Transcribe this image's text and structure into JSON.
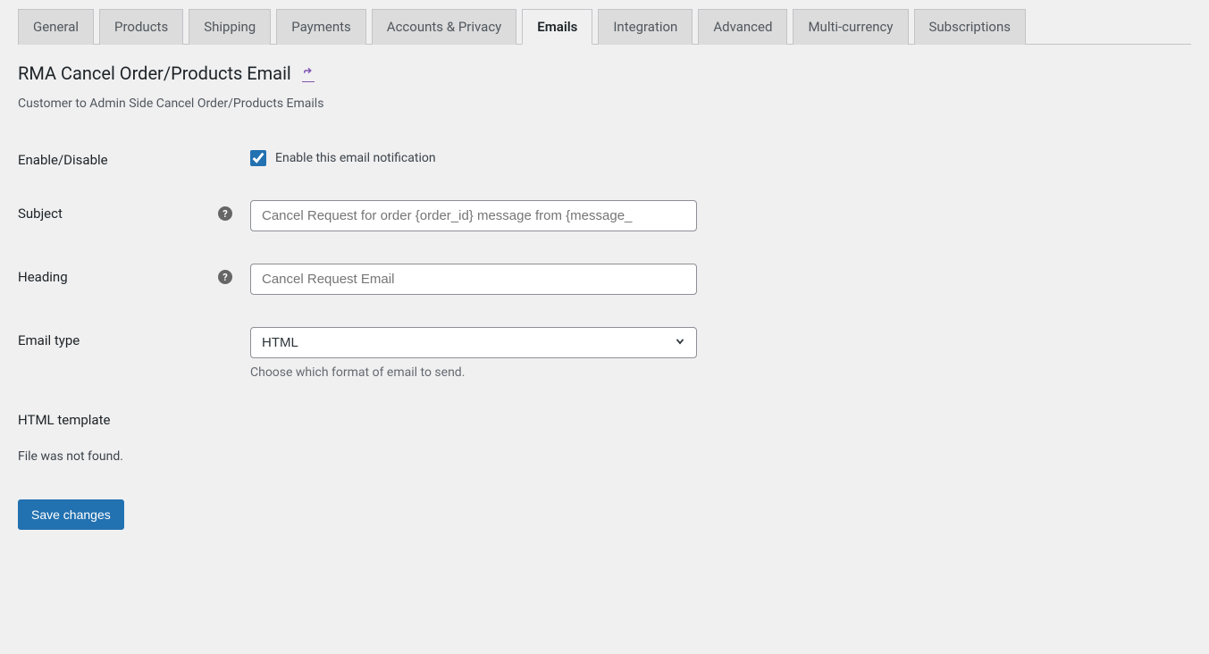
{
  "tabs": [
    {
      "label": "General"
    },
    {
      "label": "Products"
    },
    {
      "label": "Shipping"
    },
    {
      "label": "Payments"
    },
    {
      "label": "Accounts & Privacy"
    },
    {
      "label": "Emails",
      "active": true
    },
    {
      "label": "Integration"
    },
    {
      "label": "Advanced"
    },
    {
      "label": "Multi-currency"
    },
    {
      "label": "Subscriptions"
    }
  ],
  "page": {
    "title": "RMA Cancel Order/Products Email",
    "description": "Customer to Admin Side Cancel Order/Products Emails"
  },
  "form": {
    "enable": {
      "label": "Enable/Disable",
      "checkbox_label": "Enable this email notification",
      "checked": true
    },
    "subject": {
      "label": "Subject",
      "placeholder": "Cancel Request for order {order_id} message from {message_",
      "value": ""
    },
    "heading": {
      "label": "Heading",
      "placeholder": "Cancel Request Email",
      "value": ""
    },
    "email_type": {
      "label": "Email type",
      "selected": "HTML",
      "description": "Choose which format of email to send."
    },
    "html_template": {
      "label": "HTML template",
      "message": "File was not found."
    },
    "save_button": "Save changes"
  }
}
